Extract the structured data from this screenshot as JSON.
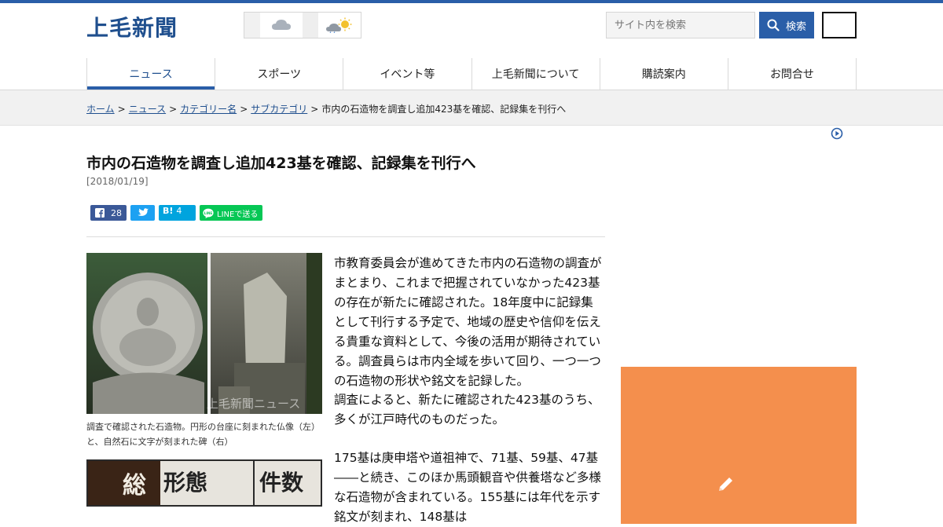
{
  "brand": {
    "logo": "上毛新聞",
    "accent": "#2a5ea8",
    "ad_color": "#f48f4d"
  },
  "weather": {
    "icons": [
      "cloud-icon",
      "cloud-sun-icon"
    ]
  },
  "search": {
    "placeholder": "サイト内を検索",
    "button_label": "検索"
  },
  "nav": {
    "items": [
      {
        "label": "ニュース"
      },
      {
        "label": "スポーツ"
      },
      {
        "label": "イベント等"
      },
      {
        "label": "上毛新聞について"
      },
      {
        "label": "購読案内"
      },
      {
        "label": "お問合せ"
      }
    ]
  },
  "breadcrumb": {
    "items": [
      "ホーム",
      "ニュース",
      "カテゴリー名",
      "サブカテゴリ"
    ],
    "current": "市内の石造物を調査し追加423基を確認、記録集を刊行へ"
  },
  "article": {
    "headline": "市内の石造物を調査し追加423基を確認、記録集を刊行へ",
    "date": "[2018/01/19]",
    "share": {
      "facebook_count": "28",
      "hatena_count": "4",
      "line_label": "LINEで送る"
    },
    "photo_watermark": "上毛新聞ニュース",
    "photo_caption": "調査で確認された石造物。円形の台座に刻まれた仏像（左）と、自然石に文字が刻まれた碑（右）",
    "table_headers": [
      "総",
      "形態",
      "件数"
    ],
    "paragraphs": [
      "市教育委員会が進めてきた市内の石造物の調査がまとまり、これまで把握されていなかった423基の存在が新たに確認された。18年度中に記録集として刊行する予定で、地域の歴史や信仰を伝える貴重な資料として、今後の活用が期待されている。調査員らは市内全域を歩いて回り、一つ一つの石造物の形状や銘文を記録した。",
      "調査によると、新たに確認された423基のうち、多くが江戸時代のものだった。",
      "175基は庚申塔や道祖神で、71基、59基、47基――と続き、このほか馬頭観音や供養塔など多様な石造物が含まれている。155基には年代を示す銘文が刻まれ、148基は"
    ]
  }
}
